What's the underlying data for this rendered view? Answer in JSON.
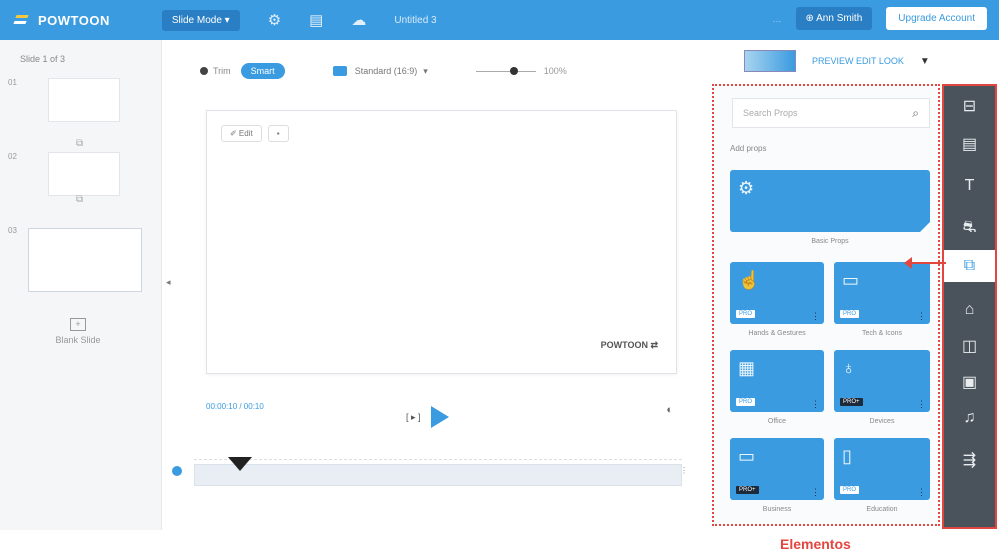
{
  "topbar": {
    "logo": "POWTOON",
    "mode": "Slide Mode ▾",
    "project_title": "Untitled 3",
    "user": "⊕ Ann Smith",
    "cta": "Upgrade Account"
  },
  "left": {
    "slide_count": "Slide 1 of 3",
    "scene_numbers": [
      "01",
      "02",
      "03"
    ],
    "blank_label": "Blank Slide",
    "blank_icon": "+"
  },
  "toolbar": {
    "toggle_label": "Trim",
    "toggle_on": "Smart",
    "resolution": "Standard (16:9)",
    "zoom_value": "100%"
  },
  "canvas": {
    "tool_edit": "✐ Edit",
    "watermark": "POWTOON ⇄"
  },
  "playbar": {
    "timecode": "00:00:10 / 00:10",
    "step": "[ ▸ ]",
    "volume_icon": "◐"
  },
  "preview": {
    "label": "PREVIEW EDIT LOOK",
    "dropdown": "▼"
  },
  "library": {
    "search_placeholder": "Search Props",
    "section": "Add props",
    "cards": [
      {
        "label": "Basic Props",
        "icon": "gear-icon",
        "badge": ""
      },
      {
        "label": "Hands & Gestures",
        "icon": "thumbs-up-icon",
        "badge": "PRO"
      },
      {
        "label": "Tech & Icons",
        "icon": "monitor-icon",
        "badge": "PRO"
      },
      {
        "label": "Office",
        "icon": "files-icon",
        "badge": "PRO"
      },
      {
        "label": "Devices",
        "icon": "bulb-icon",
        "badge": "PRO+"
      },
      {
        "label": "Business",
        "icon": "folder-icon",
        "badge": "PRO+"
      },
      {
        "label": "Education",
        "icon": "book-icon",
        "badge": "PRO"
      }
    ]
  },
  "rail": {
    "items": [
      "template-icon",
      "background-icon",
      "text-icon",
      "character-icon",
      "props-icon",
      "shapes-icon",
      "media-icon",
      "video-icon",
      "music-icon",
      "transition-icon"
    ]
  },
  "caption": "Elementos"
}
